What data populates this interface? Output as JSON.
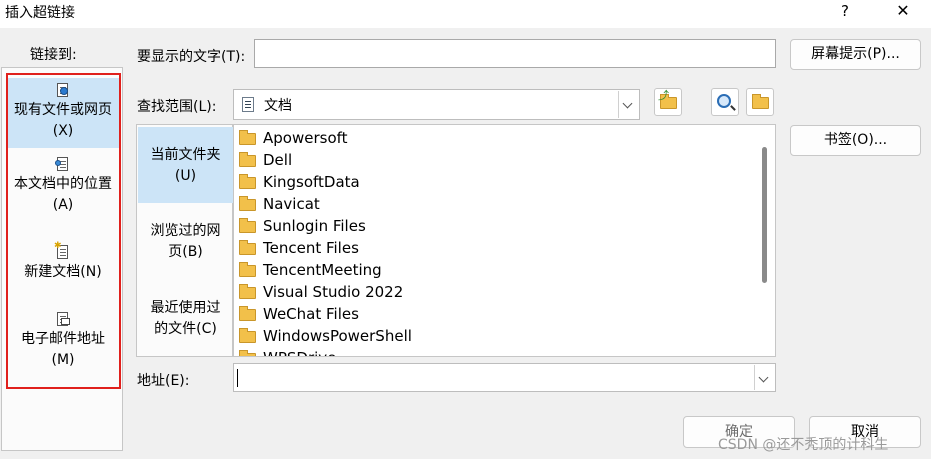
{
  "window": {
    "title": "插入超链接",
    "help_glyph": "?",
    "close_glyph": "✕"
  },
  "sidebar": {
    "label": "链接到:",
    "items": [
      {
        "line1": "现有文件或网页",
        "line2": "(X)",
        "icon": "existing-file-web-icon",
        "selected": true
      },
      {
        "line1": "本文档中的位置",
        "line2": "(A)",
        "icon": "place-in-document-icon",
        "selected": false
      },
      {
        "line1": "新建文档(N)",
        "line2": "",
        "icon": "new-document-icon",
        "selected": false
      },
      {
        "line1": "电子邮件地址",
        "line2": "(M)",
        "icon": "email-address-icon",
        "selected": false
      }
    ],
    "highlight_color": "#e0201c"
  },
  "display_text": {
    "label": "要显示的文字(T):",
    "value": ""
  },
  "screen_tip": {
    "label": "屏幕提示(P)..."
  },
  "look_in": {
    "label": "查找范围(L):",
    "value": "文档"
  },
  "toolbar": {
    "up_folder_icon": "folder-up-icon",
    "browse_web_icon": "browse-web-icon",
    "browse_file_icon": "browse-file-icon"
  },
  "bookmark": {
    "label": "书签(O)..."
  },
  "locations": [
    {
      "line1": "当前文件夹",
      "line2": "(U)",
      "selected": true
    },
    {
      "line1": "浏览过的网",
      "line2": "页(B)",
      "selected": false
    },
    {
      "line1": "最近使用过",
      "line2": "的文件(C)",
      "selected": false
    }
  ],
  "files": [
    "Apowersoft",
    "Dell",
    "KingsoftData",
    "Navicat",
    "Sunlogin Files",
    "Tencent Files",
    "TencentMeeting",
    "Visual Studio 2022",
    "WeChat Files",
    "WindowsPowerShell",
    "WPSDrive"
  ],
  "address": {
    "label": "地址(E):",
    "value": ""
  },
  "buttons": {
    "ok": "确定",
    "cancel": "取消"
  },
  "watermark": "CSDN @还不秃顶的计科生"
}
